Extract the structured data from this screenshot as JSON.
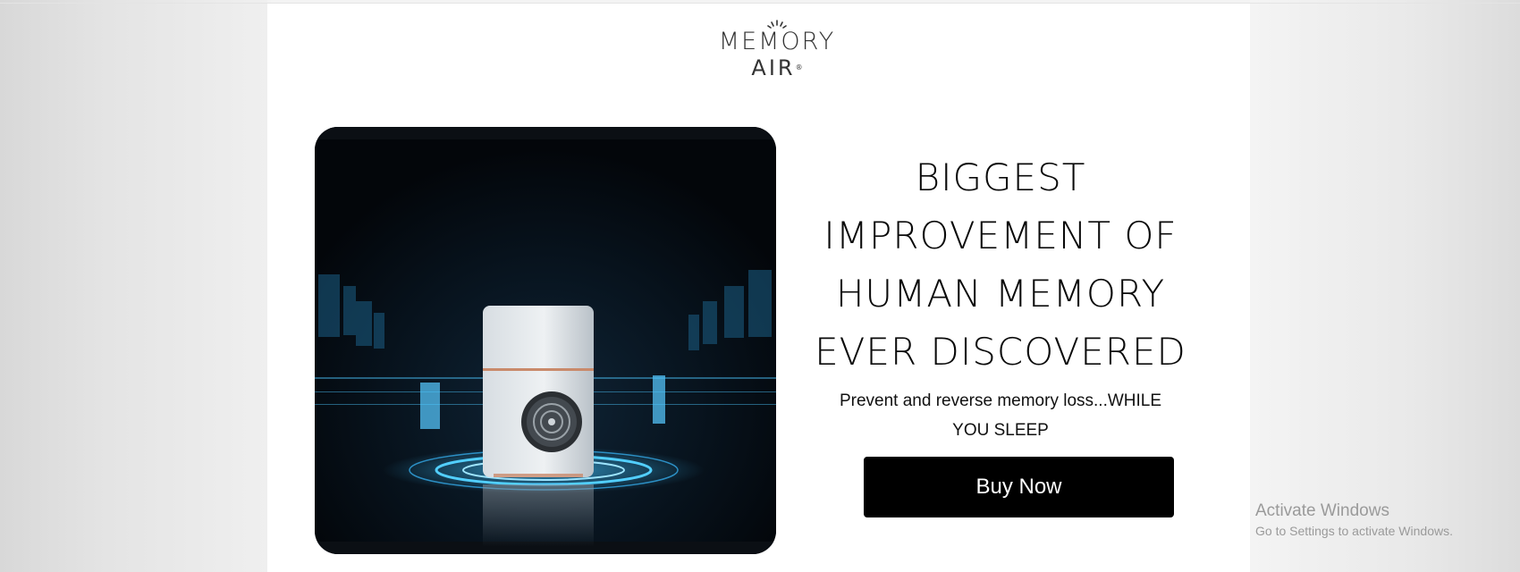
{
  "logo": {
    "line1": "MEMORY",
    "line2": "AIR",
    "registered": "®"
  },
  "hero": {
    "image_alt_icon": "air-purifier-image",
    "headline_lines": [
      "BIGGEST",
      "IMPROVEMENT OF",
      "HUMAN MEMORY",
      "EVER DISCOVERED"
    ],
    "subtitle_line1": "Prevent and reverse memory loss...WHILE",
    "subtitle_line2": "YOU SLEEP",
    "buy_button_label": "Buy Now"
  },
  "windows_watermark": {
    "title": "Activate Windows",
    "subtitle": "Go to Settings to activate Windows."
  },
  "colors": {
    "button_bg": "#000000",
    "button_text": "#ffffff",
    "accent_glow": "#2fb8ff",
    "page_bg": "#ffffff"
  }
}
